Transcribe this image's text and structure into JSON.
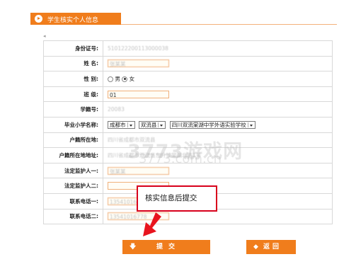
{
  "header": {
    "title": "学生核实个人信息"
  },
  "collapse_glyph": "◂",
  "fields": {
    "id_number": {
      "label": "身份证号:",
      "value": "510122200113000038"
    },
    "name": {
      "label": "姓  名:",
      "value": "张某某"
    },
    "gender": {
      "label": "性  别:",
      "options": [
        "男",
        "女"
      ],
      "selected": "女"
    },
    "class": {
      "label": "班  级:",
      "value": "01"
    },
    "student_no": {
      "label": "学籍号:",
      "value": "20083"
    },
    "primary_school": {
      "label": "毕业小学名称:",
      "city": "成都市",
      "county": "双流县",
      "school": "四川双流棠湖中学外语实验学校"
    },
    "hukou_location": {
      "label": "户籍所在地:",
      "value": "四川省成都市双流县"
    },
    "hukou_address": {
      "label": "户籍所在地地址:",
      "value": "四川省成都市双流县东升镇棠湖北路1号"
    },
    "guardian1": {
      "label": "法定监护人一:",
      "value": "张某某"
    },
    "guardian2": {
      "label": "法定监护人二:",
      "value": ""
    },
    "phone1": {
      "label": "联系电话一:",
      "value": "13541016778"
    },
    "phone2": {
      "label": "联系电话二:",
      "value": "13541016778"
    }
  },
  "watermark": {
    "line1": "3773游戏网",
    "line2": "3773.com.cn"
  },
  "tooltip": "核实信息后提交",
  "buttons": {
    "submit_icon": "🡇",
    "submit_label": "提交",
    "back_icon": "◆",
    "back_label": "返回"
  }
}
